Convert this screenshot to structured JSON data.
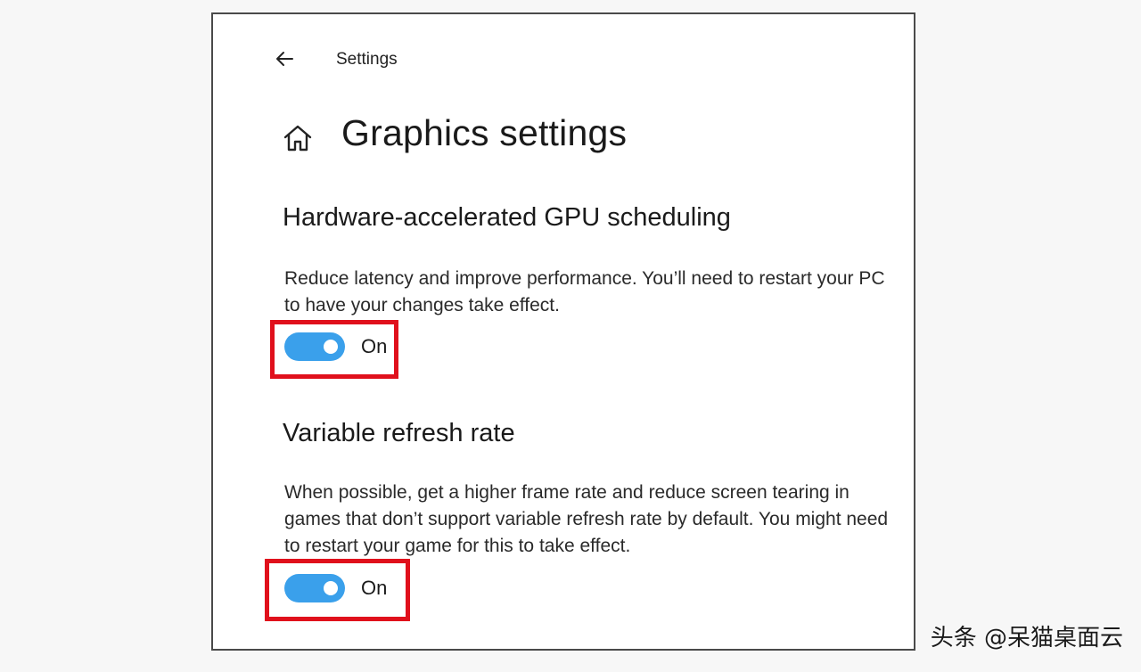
{
  "header": {
    "back_icon": "arrow-left-icon",
    "app_title": "Settings"
  },
  "page": {
    "home_icon": "home-icon",
    "title": "Graphics settings"
  },
  "sections": [
    {
      "heading": "Hardware-accelerated GPU scheduling",
      "description": "Reduce latency and improve performance. You’ll need to restart your PC to have your changes take effect.",
      "toggle": {
        "state": true,
        "label": "On"
      }
    },
    {
      "heading": "Variable refresh rate",
      "description": "When possible, get a higher frame rate and reduce screen tearing in games that don’t support variable refresh rate by default. You might need to restart your game for this to take effect.",
      "toggle": {
        "state": true,
        "label": "On"
      }
    }
  ],
  "colors": {
    "accent": "#3aa0eb",
    "highlight": "#e0101c",
    "window_border": "#4a4a4a"
  },
  "watermark": {
    "text": "头条 @呆猫桌面云"
  }
}
